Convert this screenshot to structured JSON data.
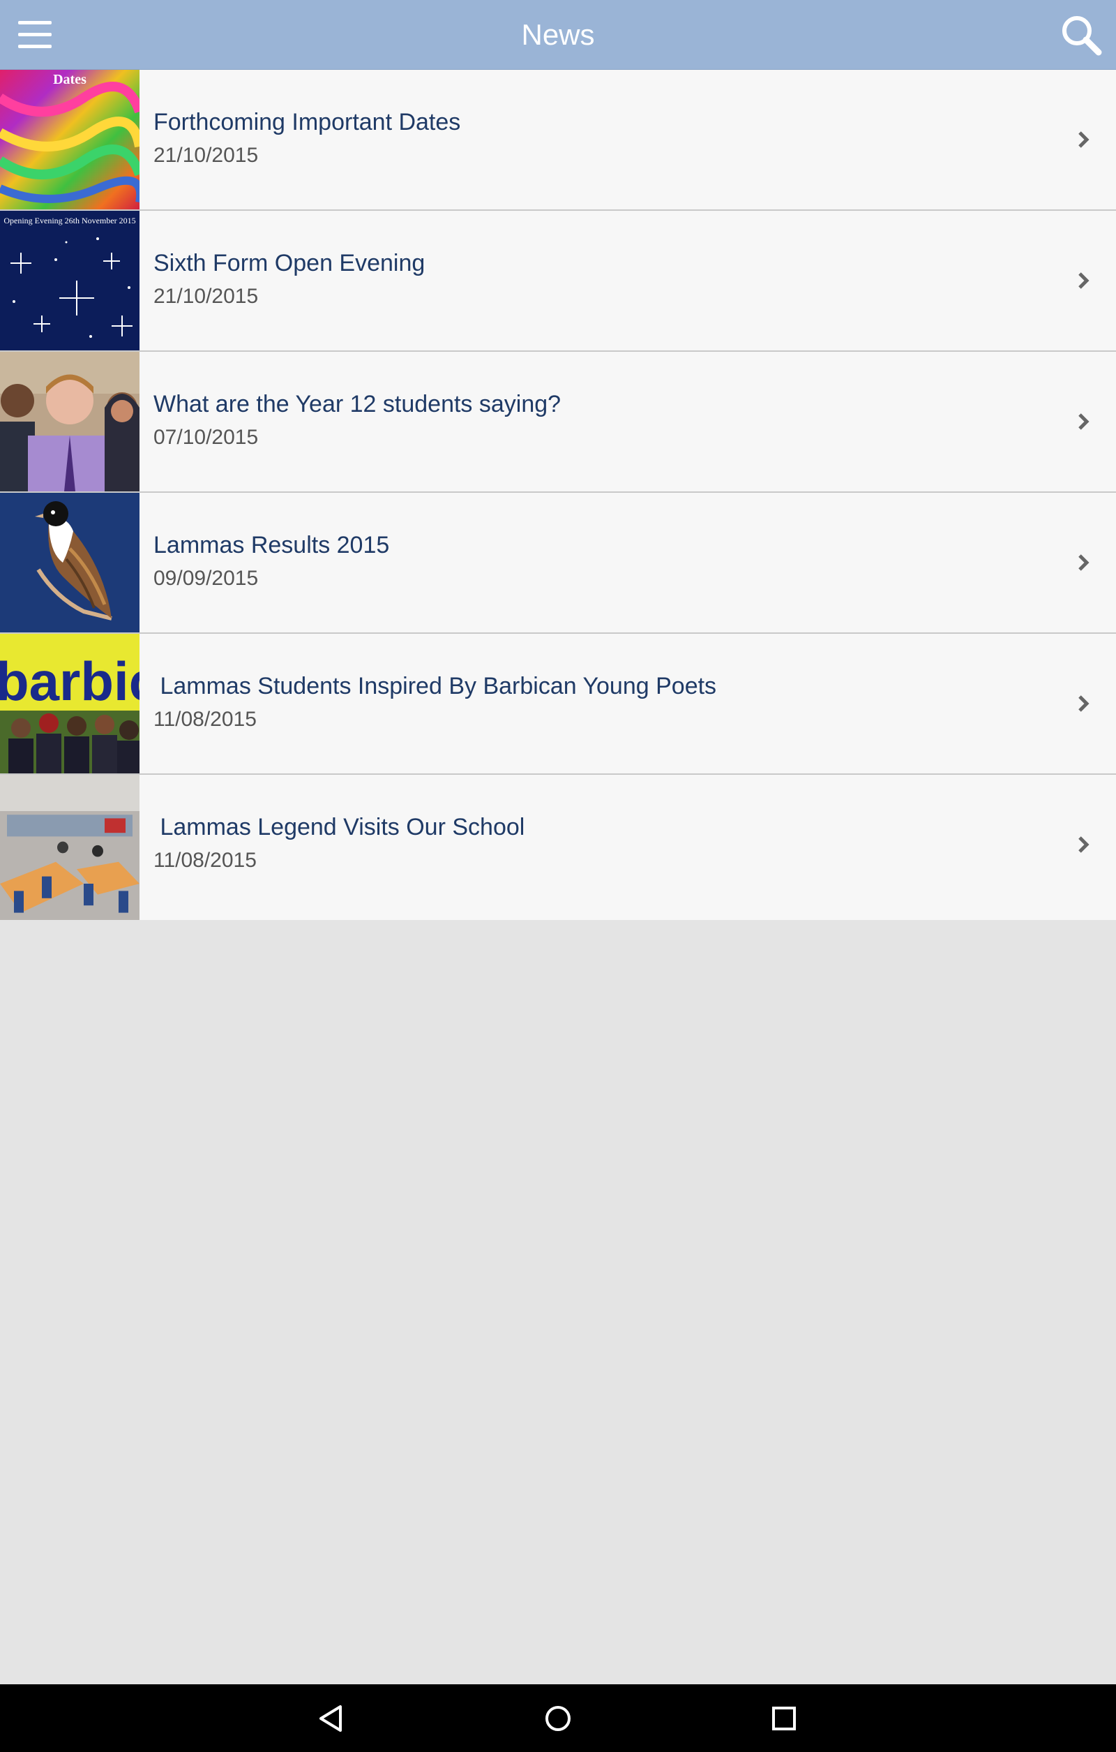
{
  "header": {
    "title": "News",
    "menu_icon": "hamburger-menu-icon",
    "search_icon": "search-icon"
  },
  "news": [
    {
      "title": "Forthcoming Important Dates",
      "date": "21/10/2015",
      "thumb_text": "Dates"
    },
    {
      "title": "Sixth Form Open Evening",
      "date": "21/10/2015",
      "thumb_text": "Opening Evening 26th November 2015"
    },
    {
      "title": "What are the Year 12 students saying?",
      "date": "07/10/2015"
    },
    {
      "title": "Lammas Results 2015",
      "date": "09/09/2015"
    },
    {
      "title": " Lammas Students Inspired By Barbican Young Poets",
      "date": "11/08/2015",
      "thumb_text": "barbic"
    },
    {
      "title": " Lammas Legend Visits Our School",
      "date": "11/08/2015"
    }
  ],
  "navbar": {
    "back_icon": "back-triangle-icon",
    "home_icon": "home-circle-icon",
    "recents_icon": "recents-square-icon"
  },
  "colors": {
    "header_bg": "#9ab4d6",
    "title_text": "#1f3a66",
    "list_bg": "#f7f7f7",
    "page_bg": "#e4e4e4"
  }
}
